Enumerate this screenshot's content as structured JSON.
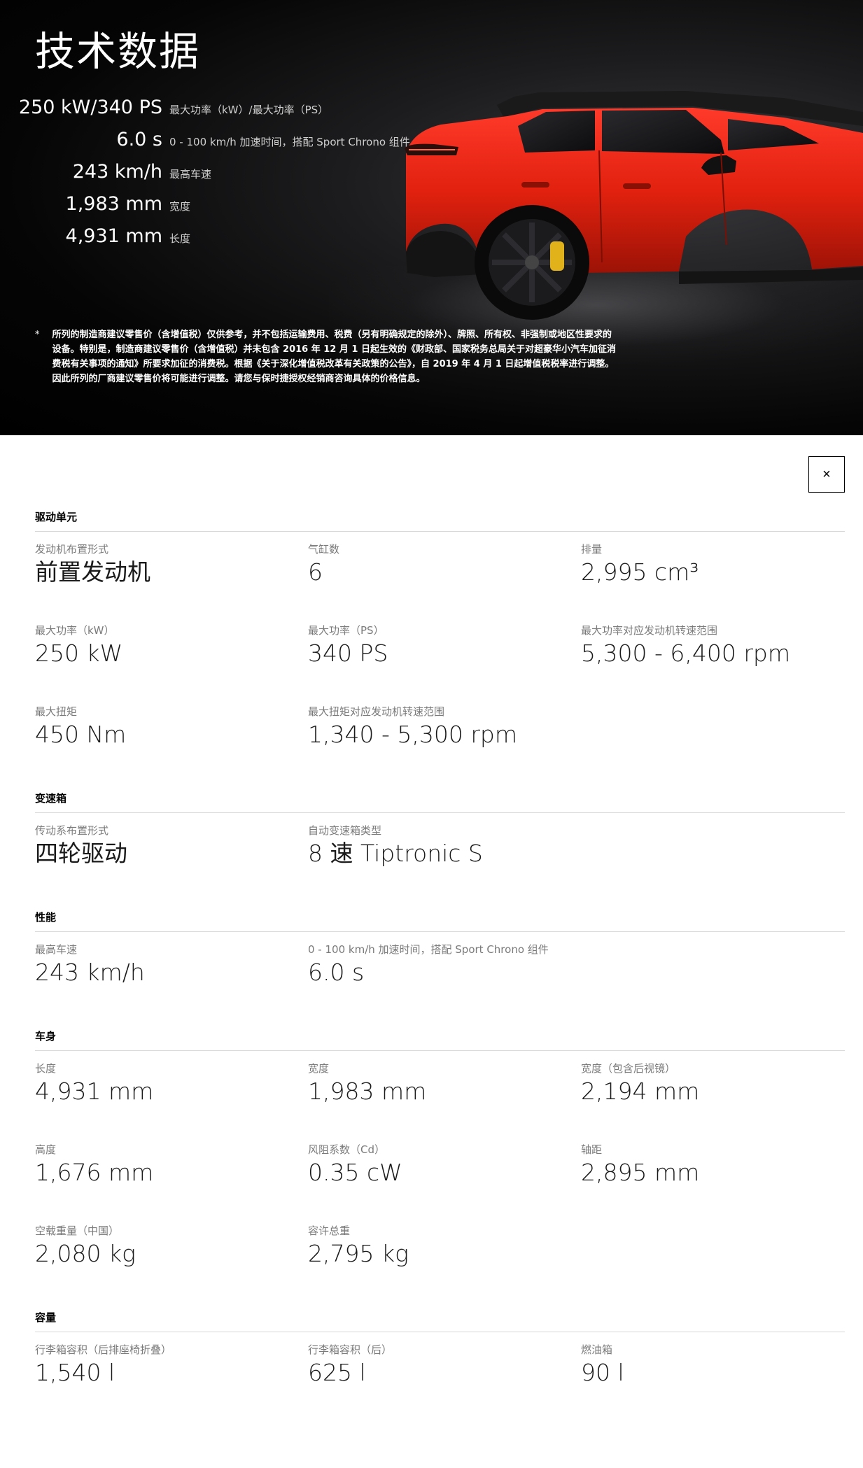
{
  "hero": {
    "title": "技术数据",
    "specs": [
      {
        "value": "250 kW/340 PS",
        "label": "最大功率（kW）/最大功率（PS）"
      },
      {
        "value": "6.0 s",
        "label": "0 - 100 km/h 加速时间，搭配 Sport Chrono 组件"
      },
      {
        "value": "243 km/h",
        "label": "最高车速"
      },
      {
        "value": "1,983 mm",
        "label": "宽度"
      },
      {
        "value": "4,931 mm",
        "label": "长度"
      }
    ],
    "disclaimer_bullet": "*",
    "disclaimer": "所列的制造商建议零售价（含增值税）仅供参考，并不包括运输费用、税费（另有明确规定的除外）、牌照、所有权、非强制或地区性要求的设备。特别是，制造商建议零售价（含增值税）并未包含 2016 年 12 月 1 日起生效的《财政部、国家税务总局关于对超豪华小汽车加征消费税有关事项的通知》所要求加征的消费税。根据《关于深化增值税改革有关政策的公告》，自 2019 年 4 月 1 日起增值税税率进行调整。因此所列的厂商建议零售价将可能进行调整。请您与保时捷授权经销商咨询具体的价格信息。"
  },
  "close_label": "×",
  "sections": {
    "drive": {
      "title": "驱动单元",
      "items": [
        {
          "label": "发动机布置形式",
          "value": "前置发动机"
        },
        {
          "label": "气缸数",
          "value": "6"
        },
        {
          "label": "排量",
          "value": "2,995 cm³"
        },
        {
          "label": "最大功率（kW）",
          "value": "250 kW"
        },
        {
          "label": "最大功率（PS）",
          "value": "340 PS"
        },
        {
          "label": "最大功率对应发动机转速范围",
          "value": "5,300 - 6,400 rpm"
        },
        {
          "label": "最大扭矩",
          "value": "450 Nm"
        },
        {
          "label": "最大扭矩对应发动机转速范围",
          "value": "1,340 - 5,300 rpm"
        }
      ]
    },
    "gearbox": {
      "title": "变速箱",
      "items": [
        {
          "label": "传动系布置形式",
          "value": "四轮驱动"
        },
        {
          "label": "自动变速箱类型",
          "value": "8 速 Tiptronic S"
        }
      ]
    },
    "performance": {
      "title": "性能",
      "items": [
        {
          "label": "最高车速",
          "value": "243 km/h"
        },
        {
          "label": "0 - 100 km/h 加速时间，搭配 Sport Chrono 组件",
          "value": "6.0 s"
        }
      ]
    },
    "body": {
      "title": "车身",
      "items": [
        {
          "label": "长度",
          "value": "4,931 mm"
        },
        {
          "label": "宽度",
          "value": "1,983 mm"
        },
        {
          "label": "宽度（包含后视镜）",
          "value": "2,194 mm"
        },
        {
          "label": "高度",
          "value": "1,676 mm"
        },
        {
          "label": "风阻系数（Cd）",
          "value": "0.35 cW"
        },
        {
          "label": "轴距",
          "value": "2,895 mm"
        },
        {
          "label": "空载重量（中国）",
          "value": "2,080 kg"
        },
        {
          "label": "容许总重",
          "value": "2,795 kg"
        }
      ]
    },
    "capacity": {
      "title": "容量",
      "items": [
        {
          "label": "行李箱容积（后排座椅折叠）",
          "value": "1,540 l"
        },
        {
          "label": "行李箱容积（后）",
          "value": "625 l"
        },
        {
          "label": "燃油箱",
          "value": "90 l"
        }
      ]
    }
  }
}
